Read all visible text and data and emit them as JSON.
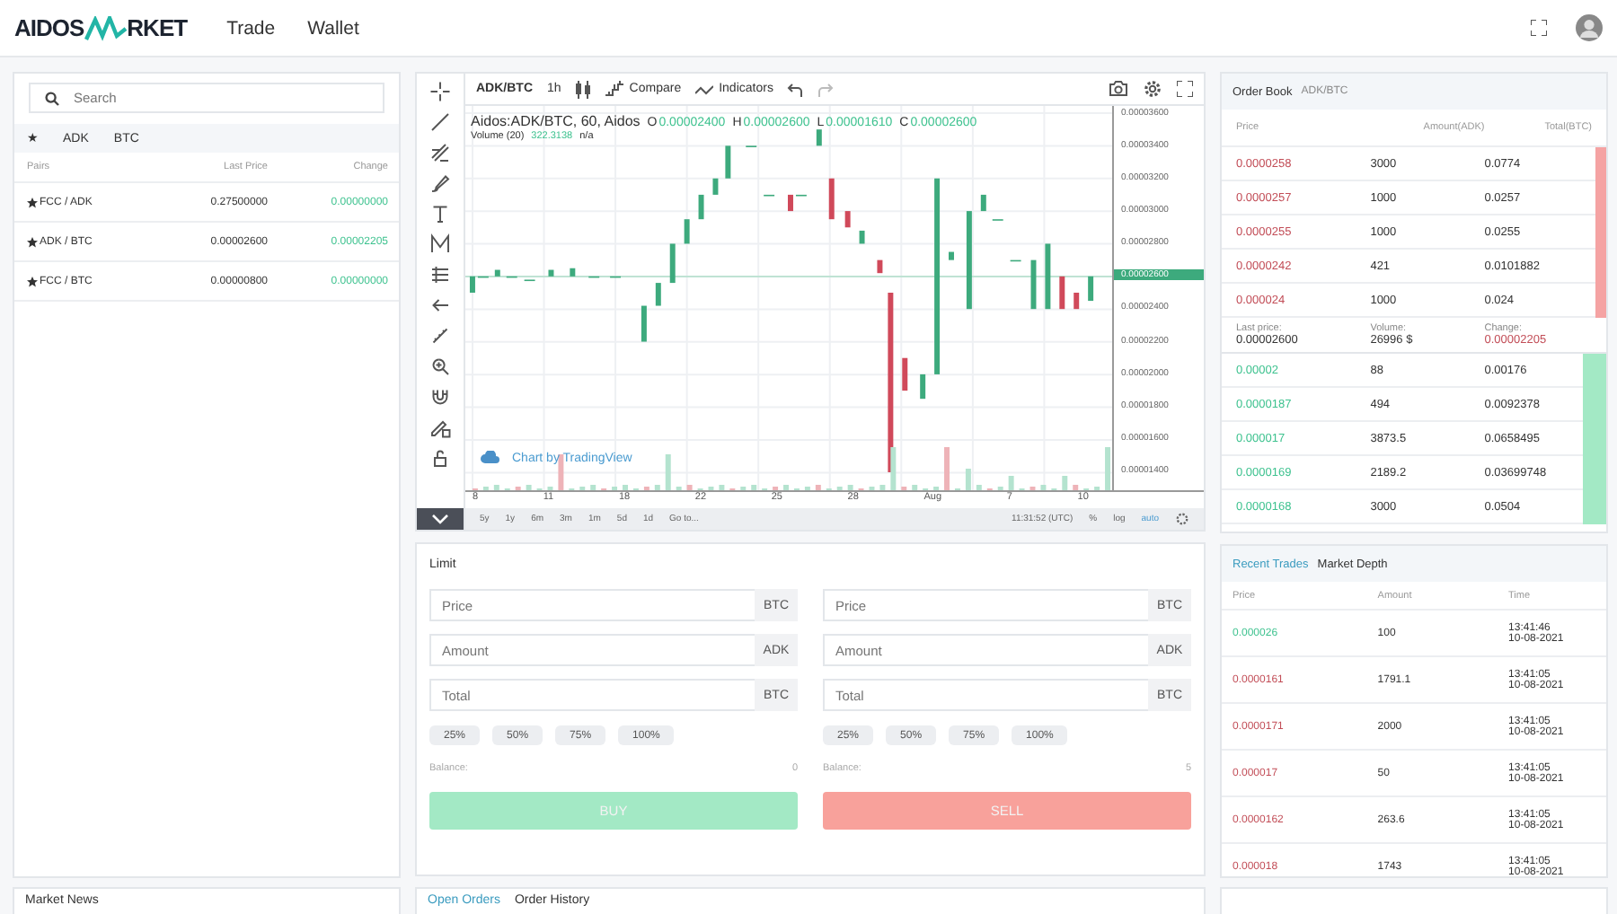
{
  "header": {
    "logo_left": "AIDOS",
    "logo_right": "RKET",
    "nav": [
      {
        "label": "Trade"
      },
      {
        "label": "Wallet"
      }
    ]
  },
  "markets": {
    "search": {
      "placeholder": "Search"
    },
    "tabs": [
      {
        "label": "★"
      },
      {
        "label": "ADK"
      },
      {
        "label": "BTC"
      }
    ],
    "columns": [
      "Pairs",
      "Last Price",
      "Change"
    ],
    "rows": [
      {
        "pair": "FCC / ADK",
        "price": "0.27500000",
        "change": "0.00000000"
      },
      {
        "pair": "ADK / BTC",
        "price": "0.00002600",
        "change": "0.00002205"
      },
      {
        "pair": "FCC / BTC",
        "price": "0.00000800",
        "change": "0.00000000"
      }
    ]
  },
  "chart": {
    "symbol": "ADK/BTC",
    "interval": "1h",
    "compare": "Compare",
    "indicators": "Indicators",
    "legend": {
      "title": "Aidos:ADK/BTC, 60, Aidos",
      "ohlc": [
        {
          "key": "O",
          "value": "0.00002400"
        },
        {
          "key": "H",
          "value": "0.00002600"
        },
        {
          "key": "L",
          "value": "0.00001610"
        },
        {
          "key": "C",
          "value": "0.00002600"
        }
      ],
      "volume_label": "Volume (20)",
      "volume_value": "322.3138",
      "volume_extra": "n/a"
    },
    "credit": "Chart by TradingView",
    "y_labels": [
      {
        "label": "0.00003600",
        "current": false
      },
      {
        "label": "0.00003400",
        "current": false
      },
      {
        "label": "0.00003200",
        "current": false
      },
      {
        "label": "0.00003000",
        "current": false
      },
      {
        "label": "0.00002800",
        "current": false
      },
      {
        "label": "0.00002600",
        "current": true
      },
      {
        "label": "0.00002400",
        "current": false
      },
      {
        "label": "0.00002200",
        "current": false
      },
      {
        "label": "0.00002000",
        "current": false
      },
      {
        "label": "0.00001800",
        "current": false
      },
      {
        "label": "0.00001600",
        "current": false
      },
      {
        "label": "0.00001400",
        "current": false
      }
    ],
    "x_labels": [
      "8",
      "11",
      "18",
      "22",
      "25",
      "28",
      "Aug",
      "7",
      "10"
    ],
    "ranges": [
      "5y",
      "1y",
      "6m",
      "3m",
      "1m",
      "5d",
      "1d"
    ],
    "goto": "Go to...",
    "clock": "11:31:52 (UTC)",
    "scale_options": [
      {
        "label": "%",
        "selected": false
      },
      {
        "label": "log",
        "selected": false
      },
      {
        "label": "auto",
        "selected": true
      }
    ]
  },
  "order_form": {
    "type": "Limit",
    "sides": [
      {
        "kind": "buy",
        "fields": [
          {
            "placeholder": "Price",
            "unit": "BTC"
          },
          {
            "placeholder": "Amount",
            "unit": "ADK"
          },
          {
            "placeholder": "Total",
            "unit": "BTC"
          }
        ],
        "percents": [
          "25%",
          "50%",
          "75%",
          "100%"
        ],
        "balance_label": "Balance:",
        "balance": "0",
        "button": "BUY"
      },
      {
        "kind": "sell",
        "fields": [
          {
            "placeholder": "Price",
            "unit": "BTC"
          },
          {
            "placeholder": "Amount",
            "unit": "ADK"
          },
          {
            "placeholder": "Total",
            "unit": "BTC"
          }
        ],
        "percents": [
          "25%",
          "50%",
          "75%",
          "100%"
        ],
        "balance_label": "Balance:",
        "balance": "5",
        "button": "SELL"
      }
    ]
  },
  "order_book": {
    "title": "Order Book",
    "pair": "ADK/BTC",
    "columns": [
      "Price",
      "Amount(ADK)",
      "Total(BTC)"
    ],
    "asks": [
      {
        "price": "0.0000258",
        "amount": "3000",
        "total": "0.0774",
        "level": 0.03
      },
      {
        "price": "0.0000257",
        "amount": "1000",
        "total": "0.0257",
        "level": 0.03
      },
      {
        "price": "0.0000255",
        "amount": "1000",
        "total": "0.0255",
        "level": 0.03
      },
      {
        "price": "0.0000242",
        "amount": "421",
        "total": "0.0101882",
        "level": 0.03
      },
      {
        "price": "0.000024",
        "amount": "1000",
        "total": "0.024",
        "level": 0.03
      }
    ],
    "summary": [
      {
        "label": "Last price:",
        "value": "0.00002600",
        "kind": "plain"
      },
      {
        "label": "Volume:",
        "value": "26996 $",
        "kind": "plain"
      },
      {
        "label": "Change:",
        "value": "0.00002205",
        "kind": "down"
      }
    ],
    "bids": [
      {
        "price": "0.00002",
        "amount": "88",
        "total": "0.00176",
        "level": 0.06
      },
      {
        "price": "0.0000187",
        "amount": "494",
        "total": "0.0092378",
        "level": 0.06
      },
      {
        "price": "0.000017",
        "amount": "3873.5",
        "total": "0.0658495",
        "level": 0.06
      },
      {
        "price": "0.0000169",
        "amount": "2189.2",
        "total": "0.03699748",
        "level": 0.06
      },
      {
        "price": "0.0000168",
        "amount": "3000",
        "total": "0.0504",
        "level": 0.06
      }
    ]
  },
  "trades": {
    "tabs": [
      {
        "label": "Recent Trades",
        "selected": true
      },
      {
        "label": "Market Depth",
        "selected": false
      }
    ],
    "columns": [
      "Price",
      "Amount",
      "Time"
    ],
    "rows": [
      {
        "kind": "buy",
        "price": "0.000026",
        "amount": "100",
        "time": "13:41:46",
        "date": "10-08-2021"
      },
      {
        "kind": "sell",
        "price": "0.0000161",
        "amount": "1791.1",
        "time": "13:41:05",
        "date": "10-08-2021"
      },
      {
        "kind": "sell",
        "price": "0.0000171",
        "amount": "2000",
        "time": "13:41:05",
        "date": "10-08-2021"
      },
      {
        "kind": "sell",
        "price": "0.000017",
        "amount": "50",
        "time": "13:41:05",
        "date": "10-08-2021"
      },
      {
        "kind": "sell",
        "price": "0.0000162",
        "amount": "263.6",
        "time": "13:41:05",
        "date": "10-08-2021"
      },
      {
        "kind": "sell",
        "price": "0.000018",
        "amount": "1743",
        "time": "13:41:05",
        "date": "10-08-2021"
      }
    ]
  },
  "news": {
    "title": "Market News"
  },
  "orders": {
    "tabs": [
      {
        "label": "Open Orders",
        "selected": true
      },
      {
        "label": "Order History",
        "selected": false
      }
    ]
  }
}
